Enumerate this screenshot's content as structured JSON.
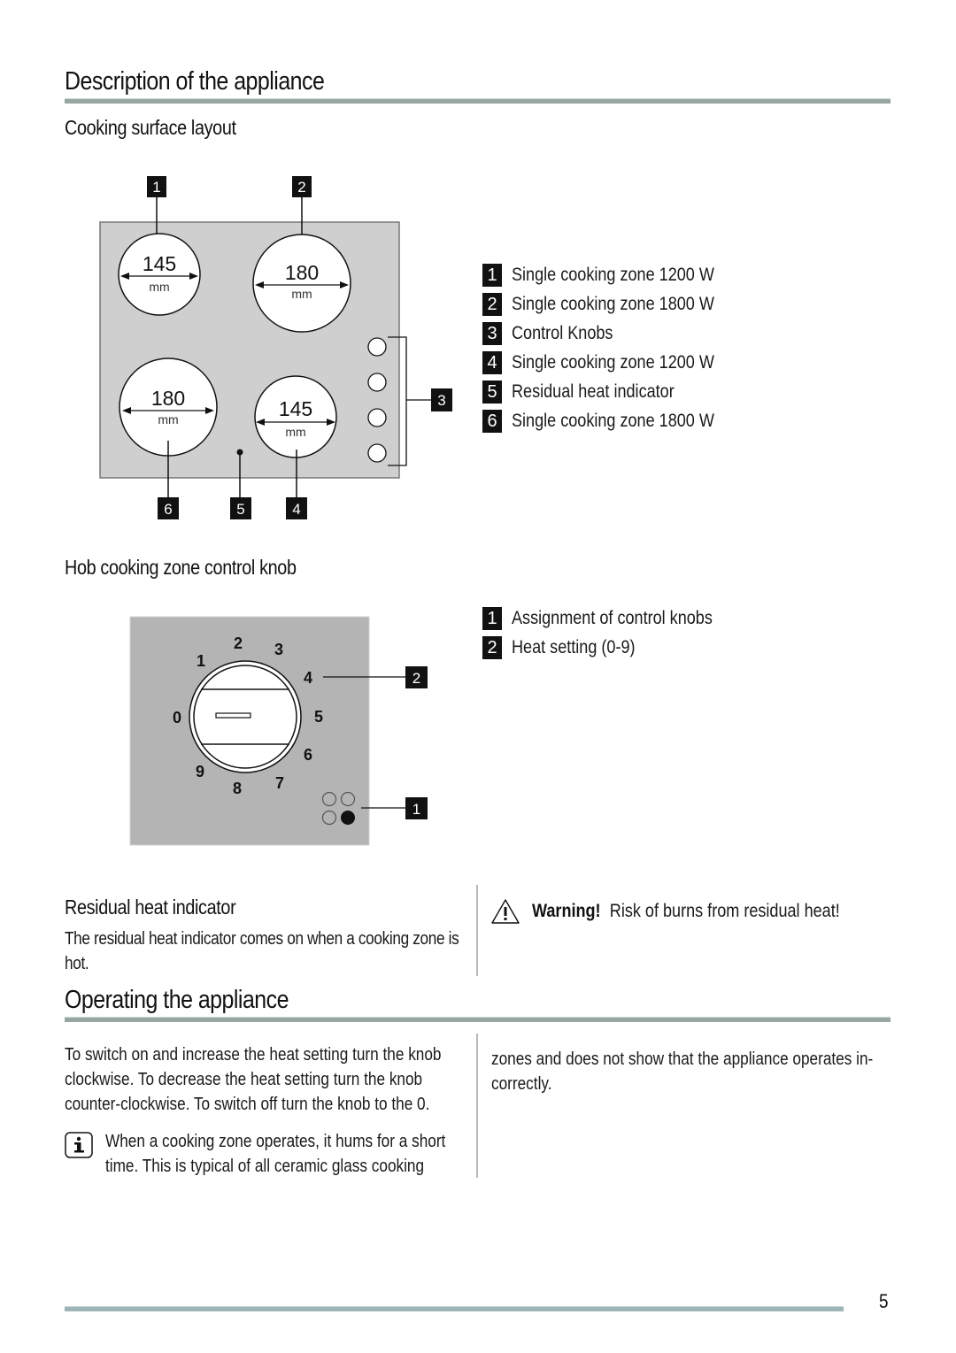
{
  "page": {
    "section1_title": "Description of the appliance",
    "section2_title": "Operating the appliance",
    "page_number": "5"
  },
  "cooking_surface": {
    "heading": "Cooking surface layout",
    "zones": [
      {
        "callout": "1",
        "diameter": "145",
        "unit": "mm"
      },
      {
        "callout": "2",
        "diameter": "180",
        "unit": "mm"
      },
      {
        "callout": "6",
        "diameter": "180",
        "unit": "mm"
      },
      {
        "callout": "4",
        "diameter": "145",
        "unit": "mm"
      }
    ],
    "callouts": {
      "indicator": "5",
      "knobs": "3"
    },
    "legend": [
      {
        "num": "1",
        "label": "Single cooking zone 1200 W"
      },
      {
        "num": "2",
        "label": "Single cooking zone 1800 W"
      },
      {
        "num": "3",
        "label": "Control Knobs"
      },
      {
        "num": "4",
        "label": "Single cooking zone 1200 W"
      },
      {
        "num": "5",
        "label": "Residual heat indicator"
      },
      {
        "num": "6",
        "label": "Single cooking zone 1800 W"
      }
    ]
  },
  "control_knob": {
    "heading": "Hob cooking zone control knob",
    "dial_numbers": [
      "0",
      "1",
      "2",
      "3",
      "4",
      "5",
      "6",
      "7",
      "8",
      "9"
    ],
    "callouts": {
      "heat_setting": "2",
      "assignment": "1"
    },
    "legend": [
      {
        "num": "1",
        "label": "Assignment of control knobs"
      },
      {
        "num": "2",
        "label": "Heat setting (0-9)"
      }
    ]
  },
  "residual_heat": {
    "heading": "Residual heat indicator",
    "text": "The residual heat indicator comes on when a cooking zone is hot.",
    "warning_label": "Warning!",
    "warning_text": "Risk of burns from residual heat!",
    "warning_icon": "warning-triangle-icon"
  },
  "operating": {
    "paragraph": "To switch on and increase the heat setting turn the knob clockwise. To decrease the heat setting turn the knob counter-clockwise. To switch off turn the knob to the 0.",
    "info_icon": "info-icon",
    "info_text_col1": "When a cooking zone operates, it hums for a short time. This is typical of all ceramic glass cooking",
    "info_text_col2": "zones and does not show that the appliance operates in-correctly."
  }
}
